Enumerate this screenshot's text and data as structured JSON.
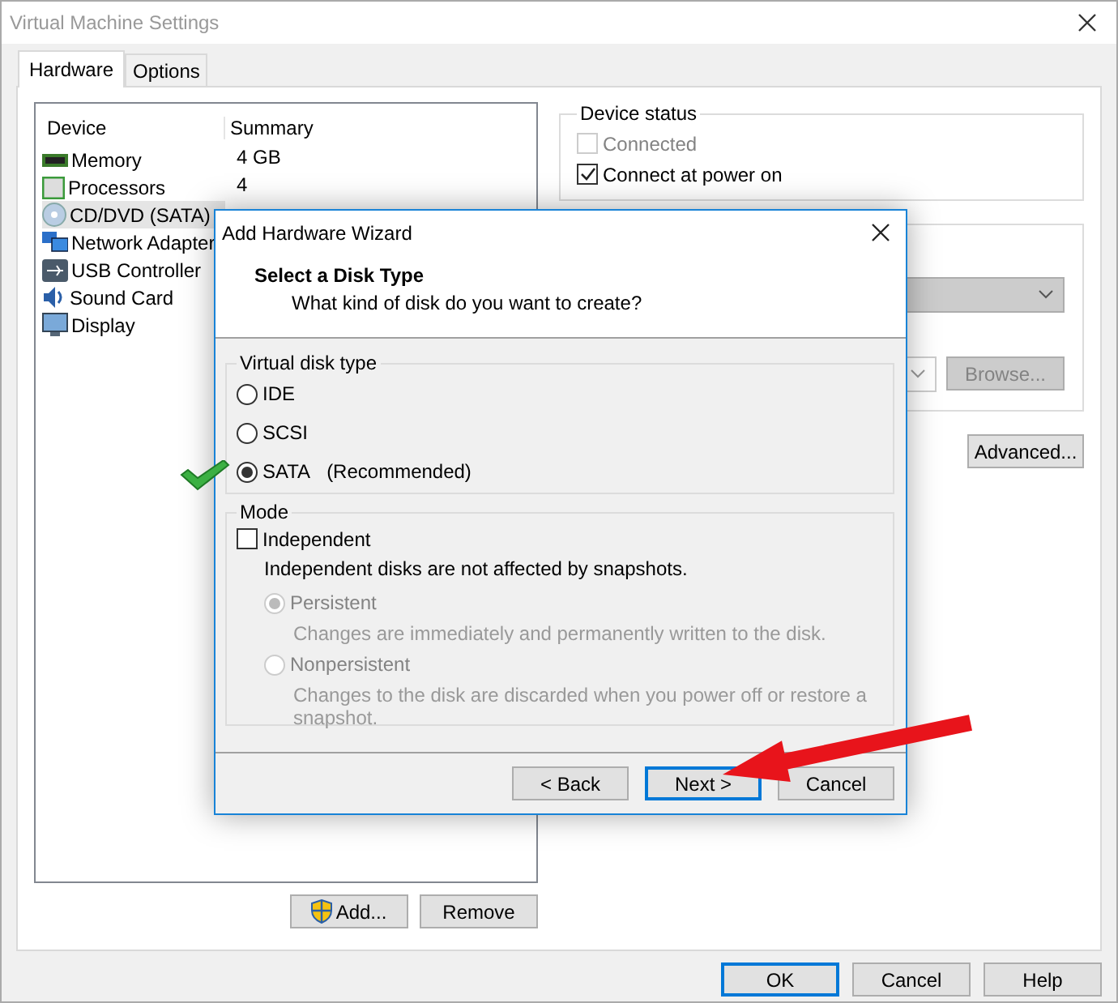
{
  "window": {
    "title": "Virtual Machine Settings"
  },
  "tabs": [
    {
      "label": "Hardware",
      "selected": true
    },
    {
      "label": "Options",
      "selected": false
    }
  ],
  "devices": {
    "columns": [
      "Device",
      "Summary"
    ],
    "rows": [
      {
        "kind": "memory",
        "name": "Memory",
        "summary": "4 GB",
        "selected": false
      },
      {
        "kind": "cpu",
        "name": "Processors",
        "summary": "4",
        "selected": false
      },
      {
        "kind": "disc",
        "name": "CD/DVD (SATA)",
        "selected": true
      },
      {
        "kind": "network",
        "name": "Network Adapter",
        "selected": false
      },
      {
        "kind": "usb",
        "name": "USB Controller",
        "selected": false
      },
      {
        "kind": "sound",
        "name": "Sound Card",
        "selected": false
      },
      {
        "kind": "display",
        "name": "Display",
        "selected": false
      }
    ]
  },
  "device_status": {
    "title": "Device status",
    "options": [
      {
        "label": "Connected",
        "checked": false,
        "disabled": true
      },
      {
        "label": "Connect at power on",
        "checked": true,
        "disabled": false
      }
    ]
  },
  "connection": {
    "browse": "Browse...",
    "advanced": "Advanced..."
  },
  "list_buttons": {
    "add": "Add...",
    "remove": "Remove"
  },
  "footer_buttons": [
    {
      "label": "OK",
      "default": true
    },
    {
      "label": "Cancel",
      "default": false
    },
    {
      "label": "Help",
      "default": false
    }
  ],
  "wizard": {
    "title": "Add Hardware Wizard",
    "heading": "Select a Disk Type",
    "subheading": "What kind of disk do you want to create?",
    "disk_type": {
      "title": "Virtual disk type",
      "options": [
        {
          "label": "IDE",
          "selected": false
        },
        {
          "label": "SCSI",
          "selected": false
        },
        {
          "label": "SATA",
          "note": "(Recommended)",
          "selected": true
        }
      ]
    },
    "mode": {
      "title": "Mode",
      "independent": {
        "label": "Independent",
        "checked": false
      },
      "independent_note": "Independent disks are not affected by snapshots.",
      "options": [
        {
          "label": "Persistent",
          "description": "Changes are immediately and permanently written to the disk.",
          "selected": true,
          "disabled": true
        },
        {
          "label": "Nonpersistent",
          "description": "Changes to the disk are discarded when you power off or restore a snapshot.",
          "selected": false,
          "disabled": true
        }
      ]
    },
    "buttons": [
      {
        "label": "< Back",
        "default": false
      },
      {
        "label": "Next >",
        "default": true
      },
      {
        "label": "Cancel",
        "default": false
      }
    ]
  }
}
